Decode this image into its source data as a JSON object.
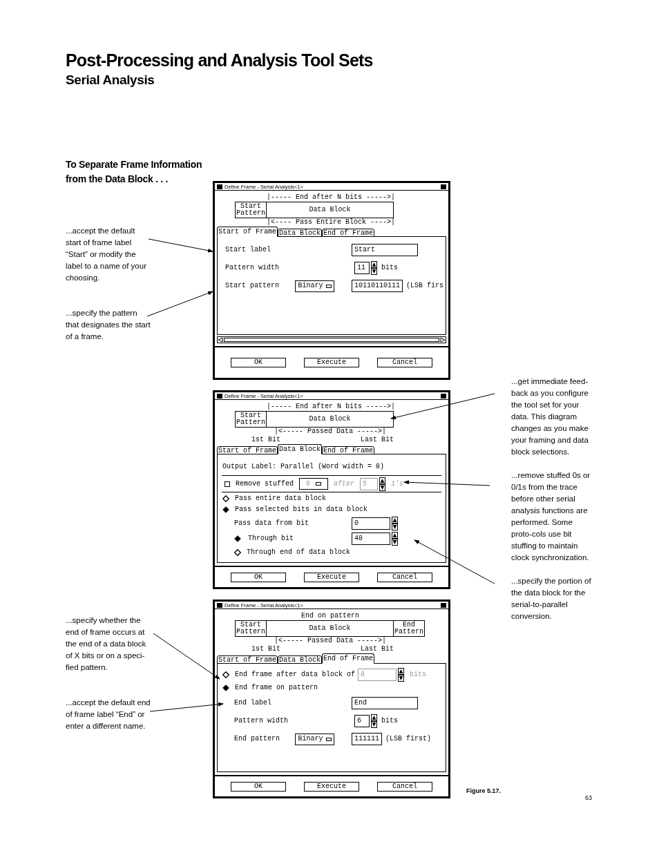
{
  "page": {
    "title": "Post-Processing and Analysis Tool Sets",
    "subtitle": "Serial Analysis",
    "section_heading": "To Separate Frame Information from the Data Block . . ."
  },
  "annotations_left": [
    {
      "text": "...accept the default start of frame label “Start” or modify  the label to a name of your choosing."
    },
    {
      "text": "...specify the pattern that designates the start of a frame."
    },
    {
      "text": "...specify whether the end of frame occurs at the end of a data block of X bits or on a speci-fied pattern."
    },
    {
      "text": "...accept the default end of frame label “End” or enter a different name."
    }
  ],
  "annotations_right": [
    {
      "text": "...get immediate feed-back as you configure the tool set for your data. This diagram changes as you make your framing and data block selections."
    },
    {
      "text": "...remove stuffed 0s or 0/1s from the trace before other serial analysis functions are performed. Some proto-cols use bit stuffing to maintain clock synchronization."
    },
    {
      "text": "...specify the portion of the data block for the serial-to-parallel conversion."
    }
  ],
  "dialogs": [
    {
      "title": "Define Frame  -  Serial Analysis<1>",
      "diagram": {
        "top_label": "|----- End after N bits ----->|",
        "blocks": [
          {
            "kind": "pattern",
            "label": "Start Pattern"
          },
          {
            "kind": "data",
            "label": "Data Block"
          }
        ],
        "bottom_label": "|<---- Pass Entire Block ---->|"
      },
      "tabs": [
        {
          "label": "Start of Frame",
          "selected": true
        },
        {
          "label": "Data Block",
          "selected": false
        },
        {
          "label": "End of Frame",
          "selected": false
        }
      ],
      "rows": [
        {
          "kind": "text_field",
          "label": "Start label",
          "value": "Start"
        },
        {
          "kind": "spinner",
          "label": "Pattern width",
          "value": "11",
          "unit": "bits"
        },
        {
          "kind": "pattern",
          "label": "Start pattern",
          "format": "Binary",
          "value": "10110110111",
          "note": "(LSB firs"
        }
      ],
      "scrollbar": true,
      "buttons": [
        "OK",
        "Execute",
        "Cancel"
      ]
    },
    {
      "title": "Define Frame  -  Serial Analysis<1>",
      "diagram": {
        "top_label": "|----- End after N bits ----->|",
        "blocks": [
          {
            "kind": "pattern",
            "label": "Start Pattern"
          },
          {
            "kind": "data",
            "label": "Data Block"
          }
        ],
        "bottom_label": "|<----- Passed Data ----->|",
        "bit_labels": [
          "1st Bit",
          "Last Bit"
        ]
      },
      "tabs": [
        {
          "label": "Start of Frame",
          "selected": false
        },
        {
          "label": "Data Block",
          "selected": true
        },
        {
          "label": "End of Frame",
          "selected": false
        }
      ],
      "rows": [
        {
          "kind": "heading",
          "text": "Output Label: Parallel (Word width = 8)"
        },
        {
          "kind": "divider"
        },
        {
          "kind": "checkbox_row",
          "label": "Remove stuffed",
          "checked": false,
          "select": "0",
          "after_label": "after",
          "value": "5",
          "unit": "1's",
          "disabled": true
        },
        {
          "kind": "divider"
        },
        {
          "kind": "radio",
          "label": "Pass entire data block",
          "selected": false
        },
        {
          "kind": "radio",
          "label": "Pass selected bits in data block",
          "selected": true,
          "children": [
            {
              "kind": "field_spinner",
              "label": "Pass data from bit",
              "value": "0"
            },
            {
              "kind": "radio_spinner",
              "label": "Through bit",
              "selected": true,
              "value": "48"
            },
            {
              "kind": "radio",
              "label": "Through end of data block",
              "selected": false
            }
          ]
        }
      ],
      "scrollbar": false,
      "buttons": [
        "OK",
        "Execute",
        "Cancel"
      ]
    },
    {
      "title": "Define Frame  -  Serial Analysis<1>",
      "diagram": {
        "top_label": "End on pattern",
        "blocks": [
          {
            "kind": "pattern",
            "label": "Start Pattern"
          },
          {
            "kind": "data",
            "label": "Data Block"
          },
          {
            "kind": "pattern",
            "label": "End Pattern"
          }
        ],
        "bottom_label": "|<----- Passed Data ----->|",
        "bit_labels": [
          "1st Bit",
          "Last Bit"
        ]
      },
      "tabs": [
        {
          "label": "Start of Frame",
          "selected": false
        },
        {
          "label": "Data Block",
          "selected": false
        },
        {
          "label": "End of Frame",
          "selected": true
        }
      ],
      "rows": [
        {
          "kind": "radio_inline_spinner",
          "label": "End frame after data block of",
          "selected": false,
          "value": "8",
          "unit": "bits",
          "disabled": true
        },
        {
          "kind": "radio",
          "label": "End frame on pattern",
          "selected": true,
          "children": [
            {
              "kind": "text_field",
              "label": "End label",
              "value": "End"
            },
            {
              "kind": "spinner",
              "label": "Pattern width",
              "value": "6",
              "unit": "bits"
            },
            {
              "kind": "pattern",
              "label": "End pattern",
              "format": "Binary",
              "value": "111111",
              "note": "(LSB first)"
            }
          ]
        }
      ],
      "scrollbar": false,
      "buttons": [
        "OK",
        "Execute",
        "Cancel"
      ]
    }
  ],
  "figure_caption": "Figure 5.17.",
  "page_number": "63"
}
